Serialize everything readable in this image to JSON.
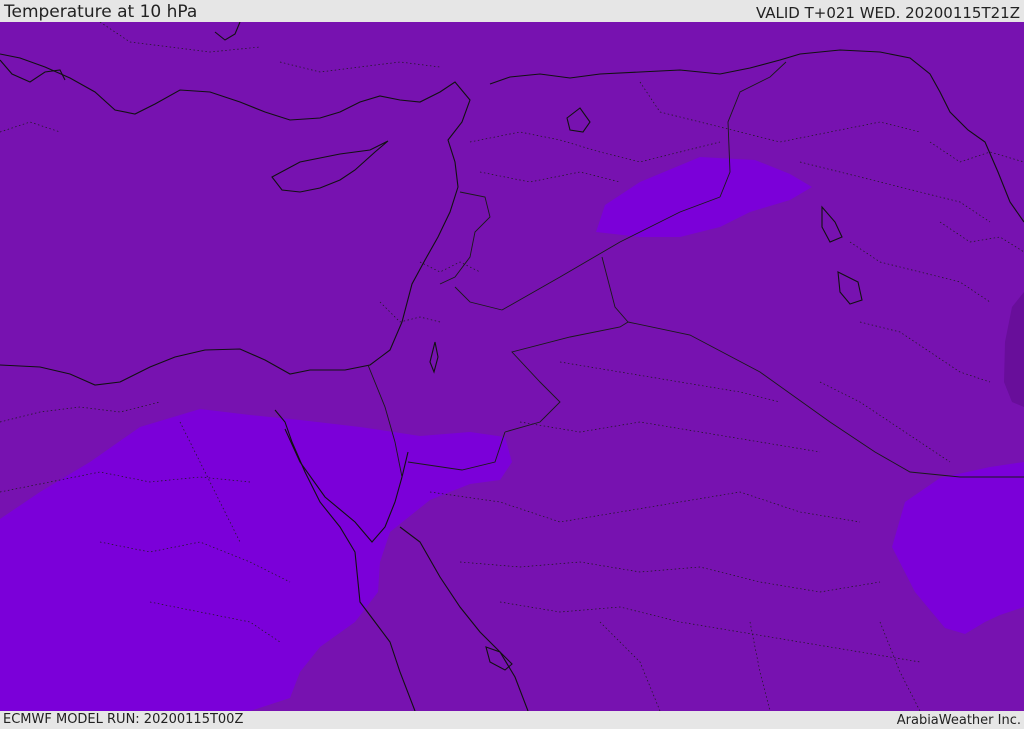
{
  "header": {
    "title": "Temperature at 10 hPa",
    "valid": "VALID T+021 WED. 20200115T21Z"
  },
  "footer": {
    "model_run": "ECMWF MODEL RUN: 20200115T00Z",
    "credit": "ArabiaWeather Inc."
  },
  "map": {
    "colors": {
      "base_field": "#7712b0",
      "cold_field": "#7b00d9",
      "warm_field": "#680e9a",
      "coastline": "#111111",
      "border": "#1a1a1a"
    }
  }
}
